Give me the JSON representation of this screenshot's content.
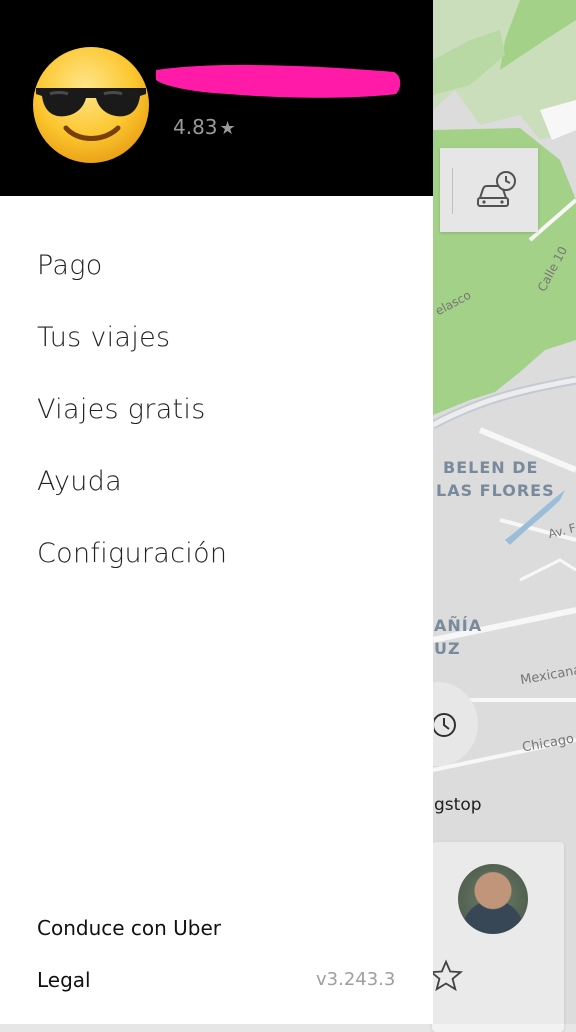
{
  "user": {
    "rating": "4.83",
    "rating_star": "★"
  },
  "menu": {
    "items": [
      {
        "label": "Pago"
      },
      {
        "label": "Tus viajes"
      },
      {
        "label": "Viajes gratis"
      },
      {
        "label": "Ayuda"
      },
      {
        "label": "Configuración"
      }
    ]
  },
  "footer": {
    "drive_label": "Conduce con Uber",
    "legal_label": "Legal",
    "version": "v3.243.3"
  },
  "map": {
    "street_velasco": "elasco",
    "street_calle10": "Calle 10",
    "neighborhood_line1": "BELEN DE",
    "neighborhood_line2": "LAS FLORES",
    "street_av": "Av. F",
    "neighborhood2_line1": "AÑÍA",
    "neighborhood2_line2": "UZ",
    "street_mexicana": "Mexicana",
    "street_chicago": "Chicago",
    "place_label": "gstop"
  },
  "colors": {
    "header_bg": "#000000",
    "redaction": "#ff1aa8",
    "park_green": "#a9d88c"
  },
  "icons": {
    "avatar": "sunglasses-emoji",
    "schedule": "car-clock-icon",
    "clock": "clock-icon",
    "favorite": "star-outline-icon"
  }
}
